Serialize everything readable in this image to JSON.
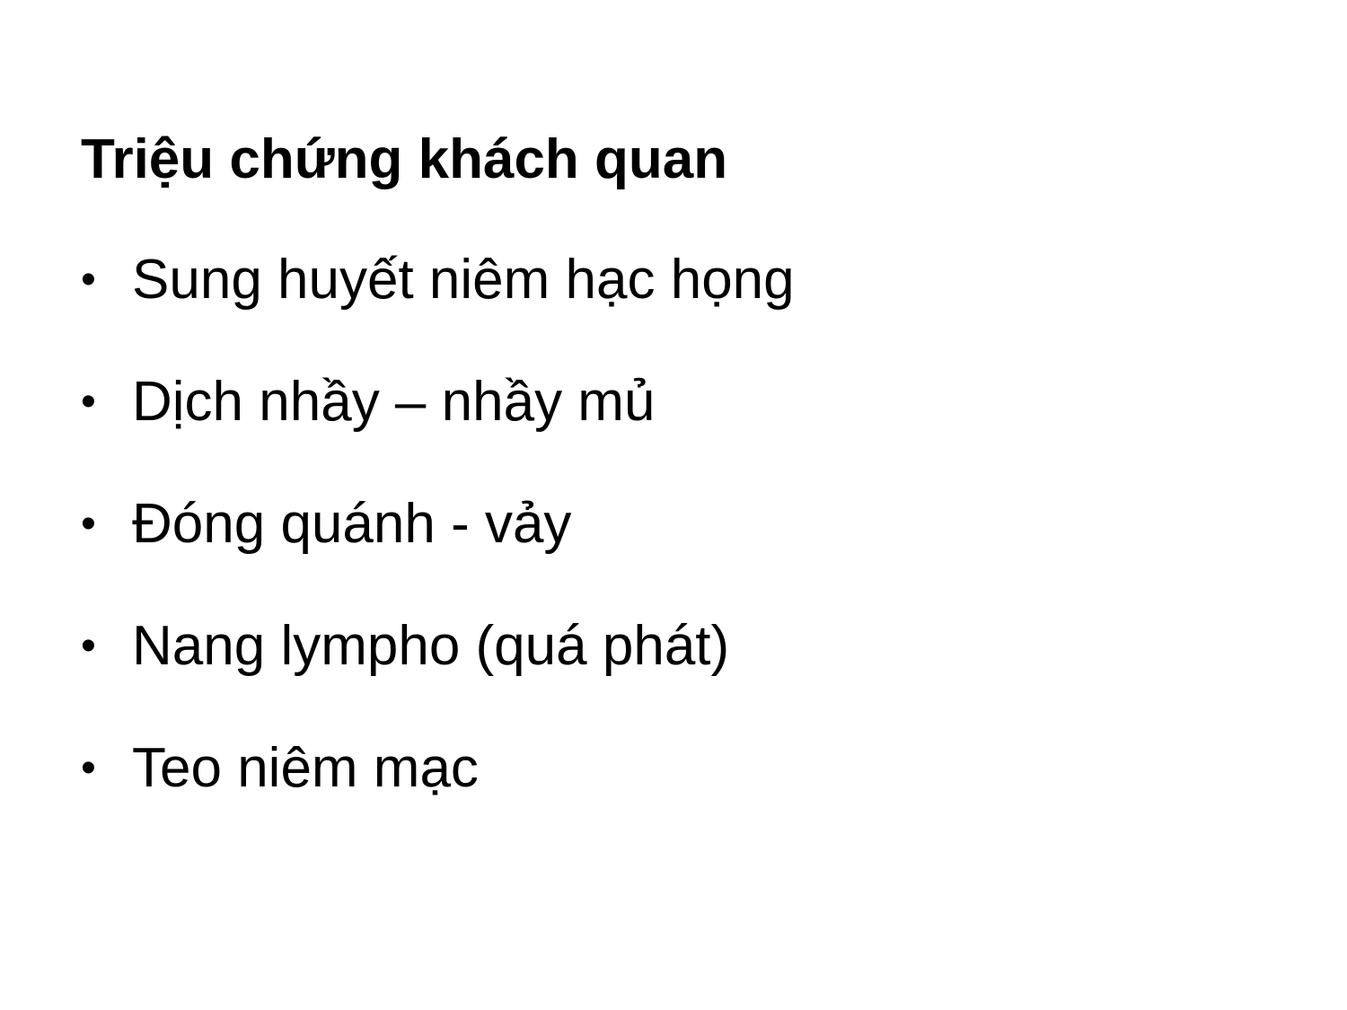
{
  "slide": {
    "title": "Triệu chứng khách quan",
    "bullet_marker": "•",
    "items": [
      {
        "text": "Sung huyết niêm hạc họng"
      },
      {
        "text": "Dịch nhầy – nhầy mủ"
      },
      {
        "text": "Đóng quánh - vảy"
      },
      {
        "text": "Nang lympho (quá phát)"
      },
      {
        "text": "Teo niêm mạc"
      }
    ]
  }
}
